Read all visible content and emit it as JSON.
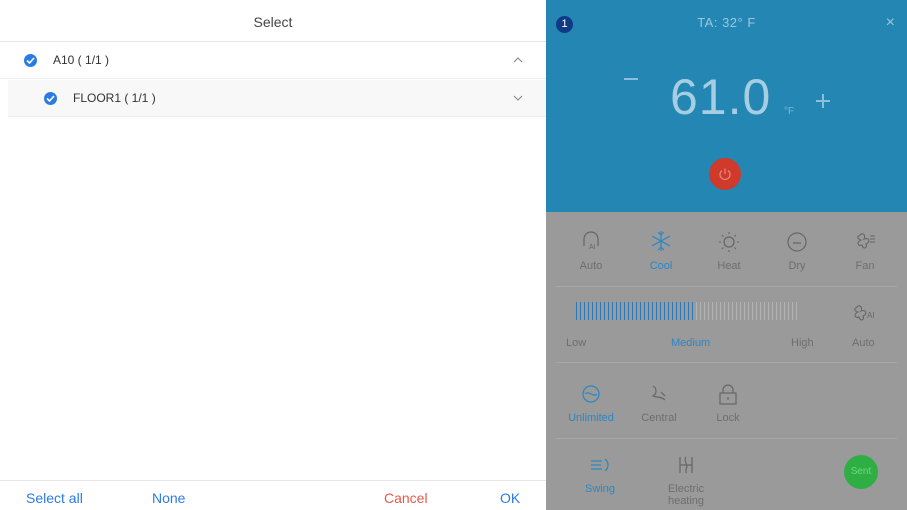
{
  "select": {
    "title": "Select",
    "rows": [
      {
        "label": "A10 ( 1/1 )",
        "checked": true,
        "expanded": true
      },
      {
        "label": "FLOOR1 ( 1/1 )",
        "checked": true,
        "expanded": false
      }
    ],
    "footer": {
      "select_all": "Select all",
      "none": "None",
      "cancel": "Cancel",
      "ok": "OK"
    }
  },
  "ac": {
    "badge": "1",
    "ambient": "TA:  32° F",
    "close": "×",
    "temperature": "61.0",
    "unit": "°F",
    "modes": [
      {
        "label": "Auto",
        "icon": "auto-ai-icon"
      },
      {
        "label": "Cool",
        "icon": "snowflake-icon",
        "active": true
      },
      {
        "label": "Heat",
        "icon": "sun-icon"
      },
      {
        "label": "Dry",
        "icon": "drop-icon"
      },
      {
        "label": "Fan",
        "icon": "fan-icon"
      }
    ],
    "fan_speed": {
      "low": "Low",
      "medium": "Medium",
      "high": "High",
      "auto": "Auto",
      "level_fraction": 0.53
    },
    "swing_modes": [
      {
        "label": "Unlimited",
        "icon": "unlimited-swing-icon",
        "active": true
      },
      {
        "label": "Central",
        "icon": "central-swing-icon"
      },
      {
        "label": "Lock",
        "icon": "lock-icon"
      }
    ],
    "extras": {
      "swing": "Swing",
      "electric_heating": "Electric heating"
    },
    "sent": "Sent"
  },
  "colors": {
    "accent": "#2c7be5",
    "cancel": "#e05a4a",
    "ac_blue": "#2486b3",
    "power": "#cf3a2a",
    "sent": "#2fae44"
  }
}
